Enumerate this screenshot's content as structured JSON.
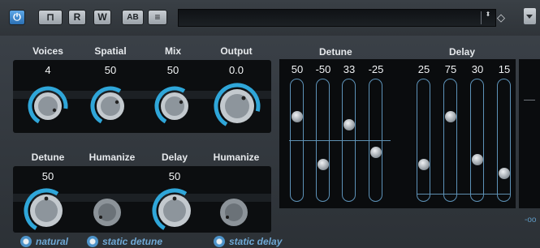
{
  "toolbar": {
    "power_icon": "power-icon",
    "bypass_icon": "bypass-icon",
    "read_label": "R",
    "write_label": "W",
    "ab_label": "AB",
    "menu_icon": "list-icon",
    "preset_name": "",
    "updown_icon": "⬍",
    "diamond_icon": "◇",
    "dropdown_icon": "chevron-down-icon"
  },
  "knobs_top": [
    {
      "label": "Voices",
      "value": "4"
    },
    {
      "label": "Spatial",
      "value": "50"
    },
    {
      "label": "Mix",
      "value": "50"
    },
    {
      "label": "Output",
      "value": "0.0"
    }
  ],
  "knobs_bottom": [
    {
      "label": "Detune",
      "value": "50"
    },
    {
      "label": "Humanize",
      "value": ""
    },
    {
      "label": "Delay",
      "value": "50"
    },
    {
      "label": "Humanize",
      "value": ""
    }
  ],
  "detune": {
    "title": "Detune",
    "values": [
      "50",
      "-50",
      "33",
      "-25"
    ],
    "levels": [
      0.75,
      0.25,
      0.66,
      0.375
    ]
  },
  "delay": {
    "title": "Delay",
    "values": [
      "25",
      "75",
      "30",
      "15"
    ],
    "levels": [
      0.25,
      0.75,
      0.3,
      0.15
    ]
  },
  "meter": {
    "readout": "-oo"
  },
  "options": {
    "natural": "natural",
    "static_detune": "static detune",
    "static_delay": "static delay"
  },
  "colors": {
    "accent": "#2fa6d9",
    "track": "#5d92b8",
    "option_text": "#6fa9d6"
  }
}
